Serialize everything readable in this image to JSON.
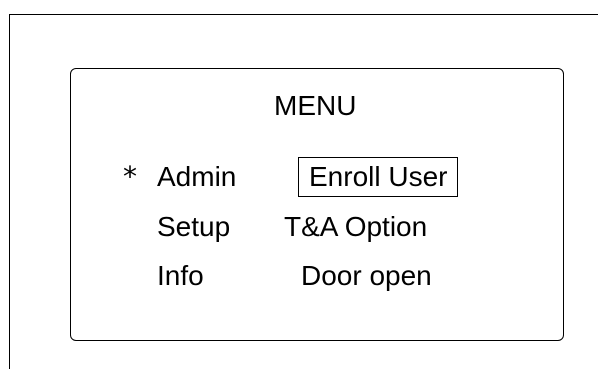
{
  "menu": {
    "title": "MENU",
    "cursor_symbol": "*",
    "left_items": [
      {
        "label": "Admin"
      },
      {
        "label": "Setup"
      },
      {
        "label": "Info"
      }
    ],
    "right_items": [
      {
        "label": "Enroll User"
      },
      {
        "label": "T&A Option"
      },
      {
        "label": "Door open"
      }
    ]
  }
}
